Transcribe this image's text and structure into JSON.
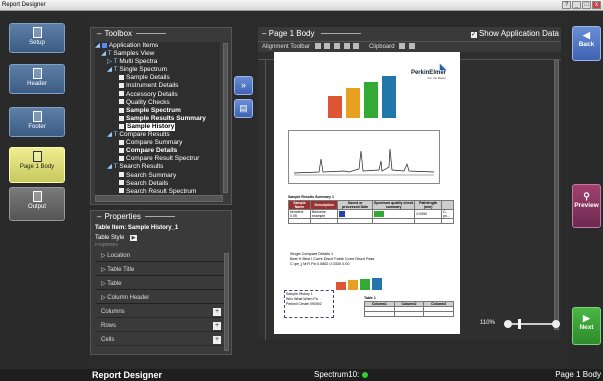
{
  "window": {
    "title": "Report Designer"
  },
  "leftnav": {
    "items": [
      {
        "label": "Setup"
      },
      {
        "label": "Header"
      },
      {
        "label": "Footer"
      },
      {
        "label": "Page 1 Body"
      },
      {
        "label": "Output"
      }
    ]
  },
  "toolbox": {
    "title": "Toolbox",
    "tree": [
      "Application Items",
      "Samples View",
      "Multi Spectra",
      "Single Spectrum",
      "Sample Details",
      "Instrument Details",
      "Accessory Details",
      "Quality Checks",
      "Sample Spectrum",
      "Sample Results Summary",
      "Sample History",
      "Compare Results",
      "Compare Summary",
      "Compare Details",
      "Compare Result Spectrur",
      "Search Results",
      "Search Summary",
      "Search Details",
      "Search Result Spectrum"
    ]
  },
  "properties": {
    "title": "Properties",
    "table_item": "Table Item: Sample History_1",
    "table_style": "Table Style",
    "cut_label": "Properties",
    "groups": [
      "Location",
      "Table Title",
      "Table",
      "Column Header"
    ],
    "fields": [
      "Columns",
      "Rows",
      "Cells"
    ]
  },
  "page_panel": {
    "title": "Page 1 Body",
    "show_app_data": "Show Application Data",
    "alignment_toolbar": "Alignment Toolbar",
    "clipboard": "Clipboard",
    "zoom": "110%"
  },
  "page": {
    "brand": "PerkinElmer",
    "brand_sub": "For the Better",
    "summary_title": "Sample Results Summary 1",
    "summary_headers": [
      "Sample Name",
      "Description",
      "Saved or processed Date",
      "Spectrum quality check summary",
      "Pathlength (mm)"
    ],
    "summary_row": [
      "benzene 0.05",
      "Benzene example",
      "",
      "",
      "0.0050",
      "C-po..."
    ],
    "compare_title": "Single Compare Details 1",
    "compare_row1": "Best H   Best I   Corre   Discri   Faste   Corre   Discri   Pass",
    "compare_row2": "C:\\pe_j  M:R Pa  0.0862        0.0330  0.00",
    "history_title": "Sample History 1",
    "history_header": "Who   What   When   Pa",
    "history_row": "Perkinil Create 09/09/2",
    "table1_title": "Table 1",
    "table1_headers": [
      "Column1",
      "Column2",
      "Column3"
    ]
  },
  "rightnav": {
    "back": "Back",
    "preview": "Preview",
    "next": "Next"
  },
  "status": {
    "app": "Report Designer",
    "spectrum": "Spectrum10:",
    "page": "Page 1 Body"
  },
  "colors": {
    "accent": "#4a6fd0",
    "green": "#3aa635",
    "purple": "#8a3b6a"
  }
}
